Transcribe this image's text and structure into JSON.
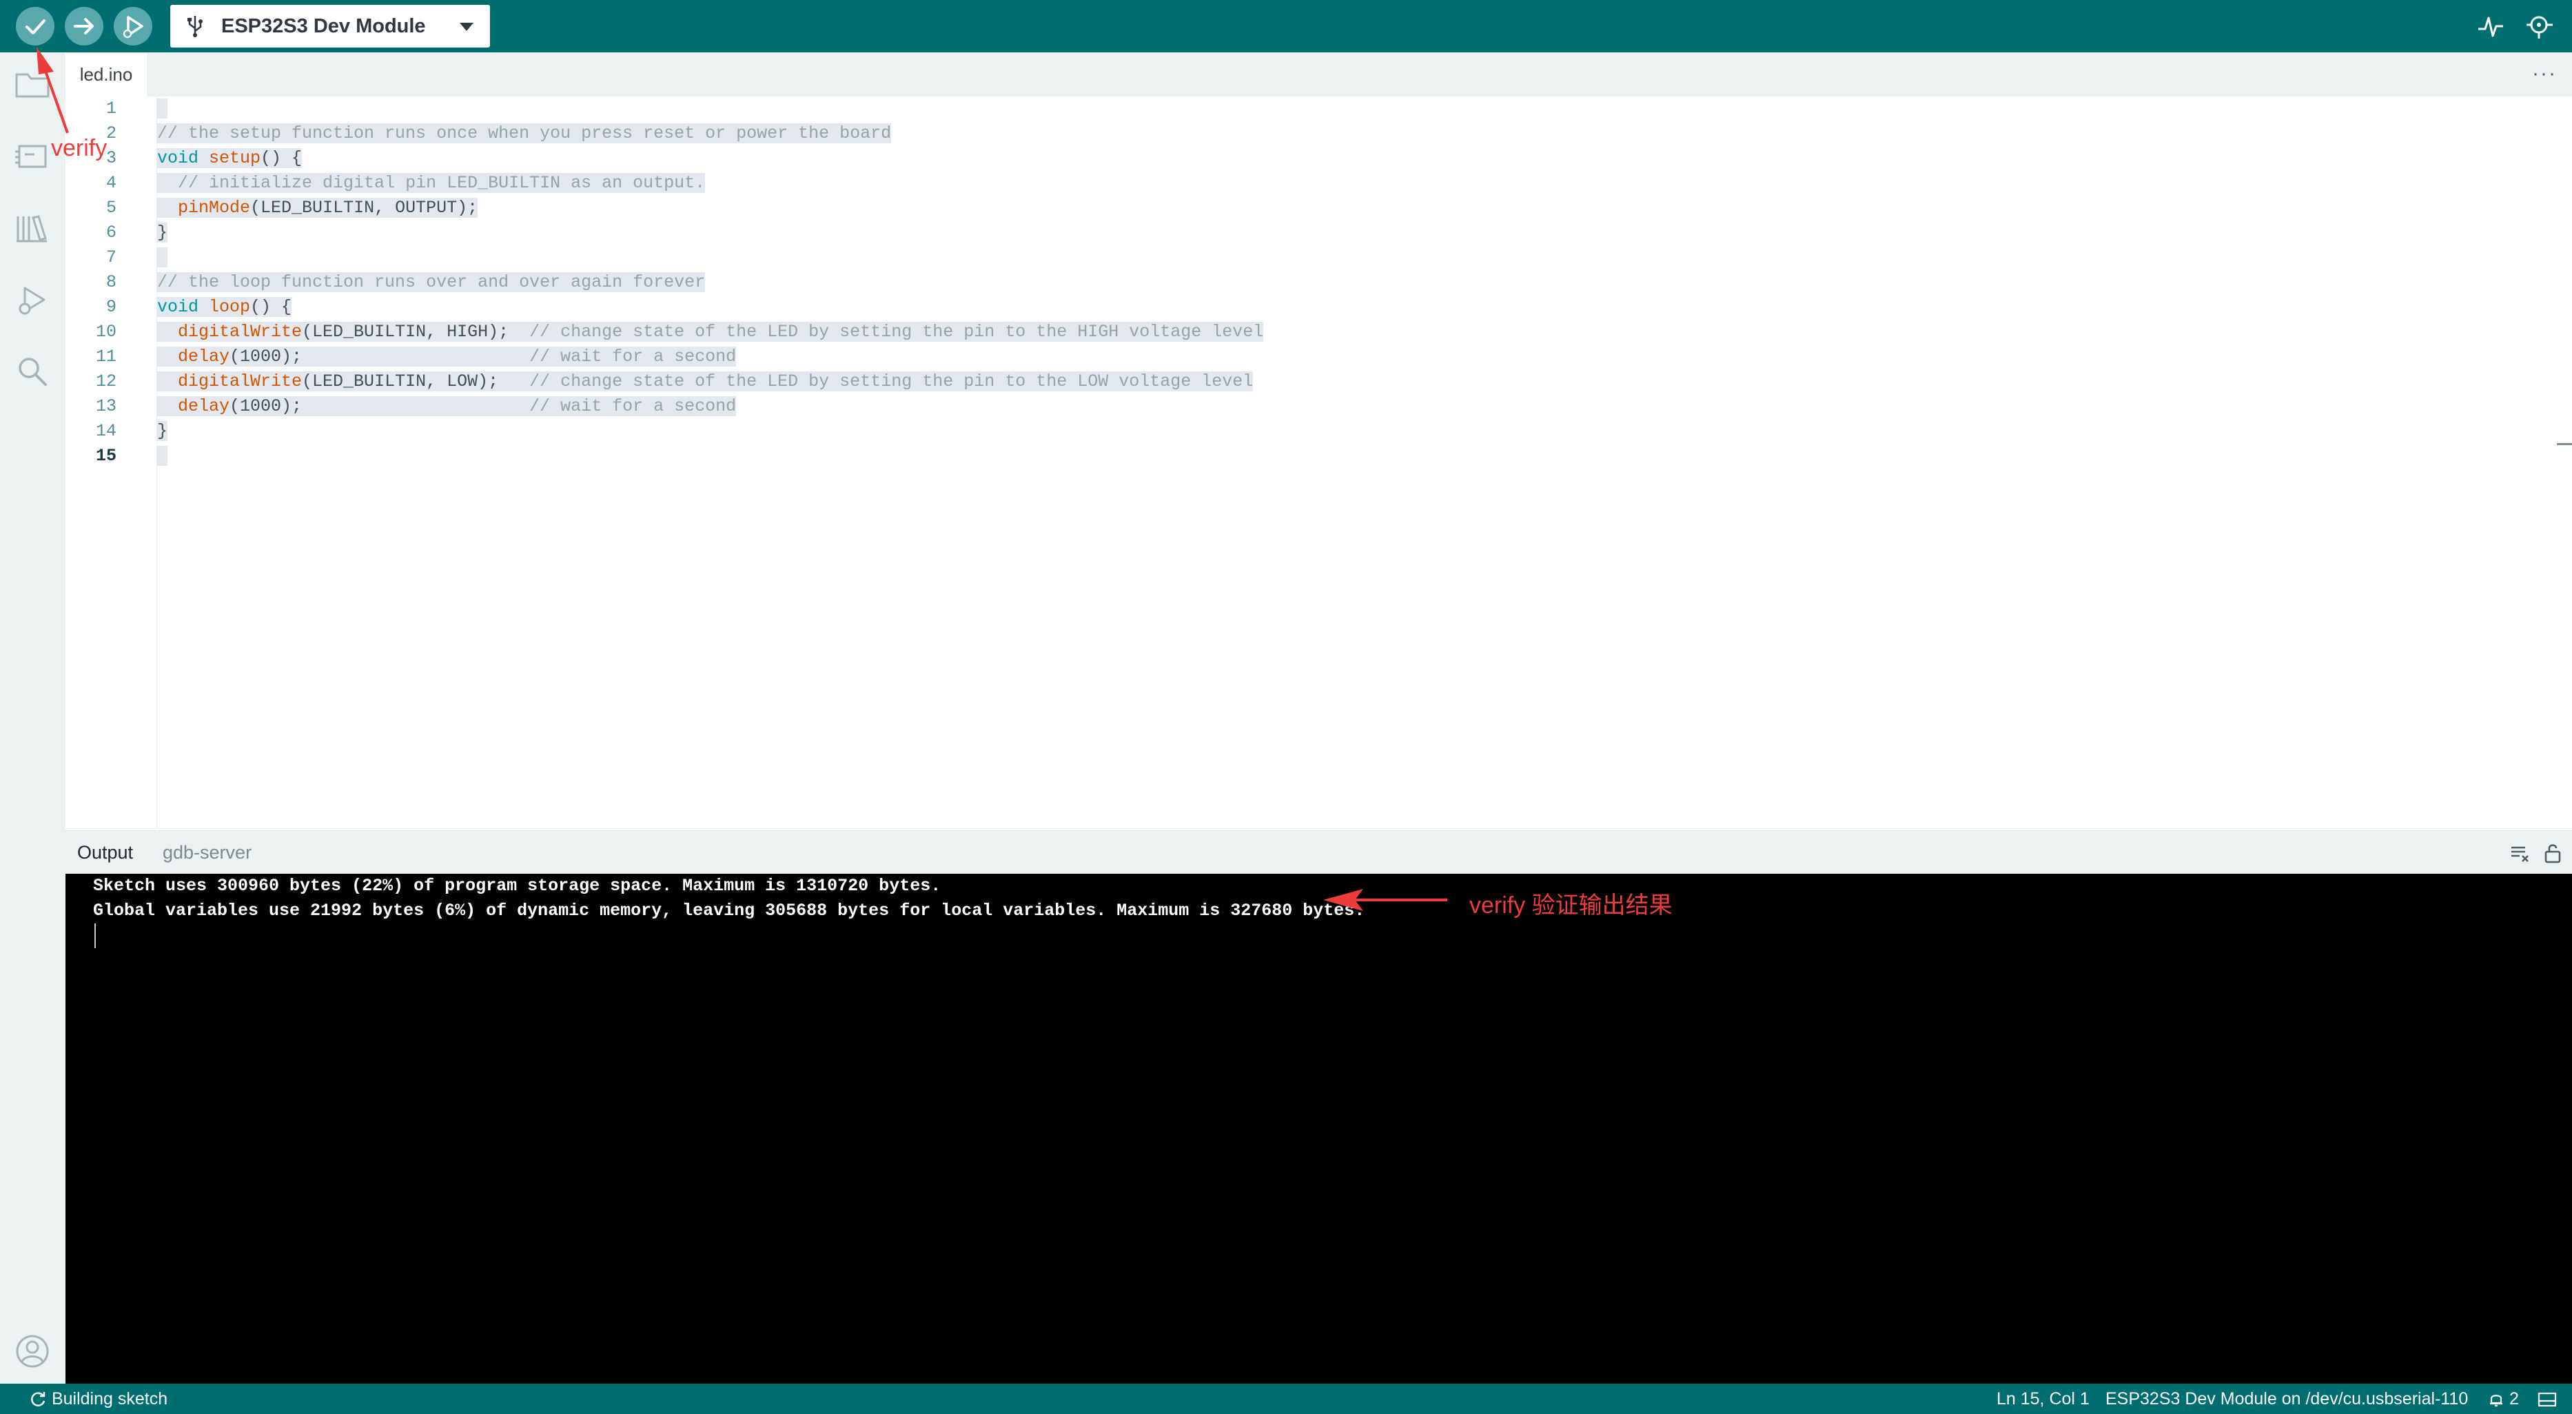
{
  "toolbar": {
    "board": "ESP32S3 Dev Module",
    "buttons": [
      "verify-button",
      "upload-button",
      "debug-button"
    ]
  },
  "tabs": [
    {
      "label": "led.ino"
    }
  ],
  "editor": {
    "line_numbers": [
      "1",
      "2",
      "3",
      "4",
      "5",
      "6",
      "7",
      "8",
      "9",
      "10",
      "11",
      "12",
      "13",
      "14",
      "15"
    ],
    "active_line": 15
  },
  "panel": {
    "tabs": [
      {
        "label": "Output"
      },
      {
        "label": "gdb-server"
      }
    ]
  },
  "output": {
    "lines": [
      "Sketch uses 300960 bytes (22%) of program storage space. Maximum is 1310720 bytes.",
      "Global variables use 21992 bytes (6%) of dynamic memory, leaving 305688 bytes for local variables. Maximum is 327680 bytes."
    ]
  },
  "status": {
    "left": "Building sketch",
    "cursor_pos": "Ln 15, Col 1",
    "board_port": "ESP32S3 Dev Module on /dev/cu.usbserial-110",
    "notifications": "2"
  },
  "annotations": {
    "verify_label": "verify",
    "output_label": "verify 验证输出结果",
    "color": "#ee3b3b"
  },
  "colors": {
    "toolbar": "#006d70",
    "keyword": "#00979c",
    "function": "#d35400",
    "comment": "#95a5a6"
  }
}
